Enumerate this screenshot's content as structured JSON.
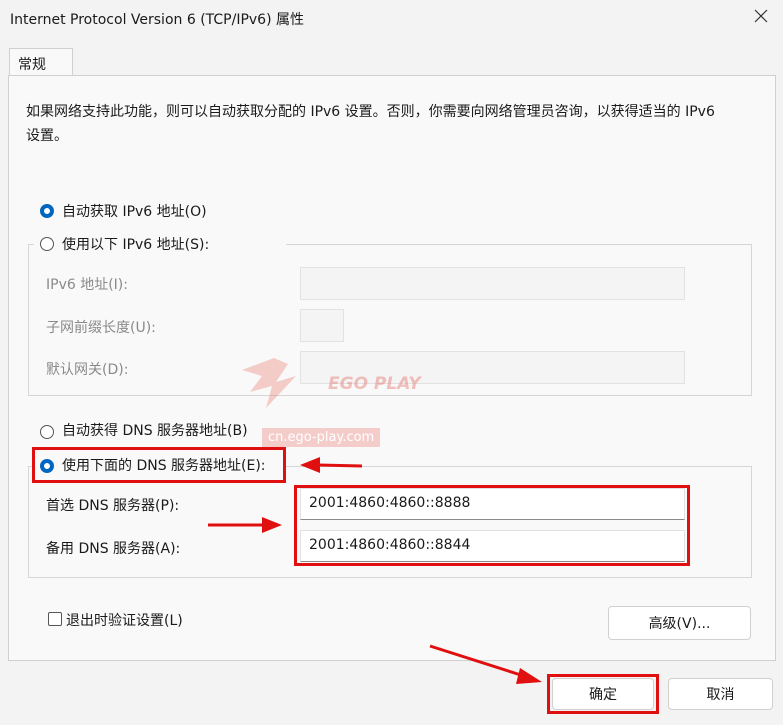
{
  "window": {
    "title": "Internet Protocol Version 6 (TCP/IPv6) 属性"
  },
  "tabs": {
    "general": "常规"
  },
  "description": "如果网络支持此功能，则可以自动获取分配的 IPv6 设置。否则，你需要向网络管理员咨询，以获得适当的 IPv6 设置。",
  "ip": {
    "auto_label": "自动获取 IPv6 地址(O)",
    "manual_label": "使用以下 IPv6 地址(S):",
    "address_label": "IPv6 地址(I):",
    "prefix_label": "子网前缀长度(U):",
    "gateway_label": "默认网关(D):",
    "address_value": "",
    "prefix_value": "",
    "gateway_value": ""
  },
  "dns": {
    "auto_label": "自动获得 DNS 服务器地址(B)",
    "manual_label": "使用下面的 DNS 服务器地址(E):",
    "preferred_label": "首选 DNS 服务器(P):",
    "alternate_label": "备用 DNS 服务器(A):",
    "preferred_value": "2001:4860:4860::8888",
    "alternate_value": "2001:4860:4860::8844"
  },
  "validate_on_exit": "退出时验证设置(L)",
  "buttons": {
    "advanced": "高级(V)...",
    "ok": "确定",
    "cancel": "取消"
  },
  "watermark": {
    "brand": "EGO PLAY",
    "url": "cn.ego-play.com"
  },
  "colors": {
    "accent": "#0067c0",
    "highlight": "#e01010"
  }
}
